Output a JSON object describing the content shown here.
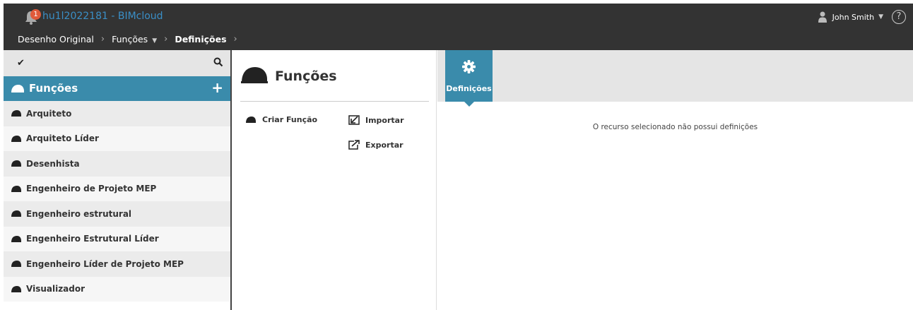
{
  "topbar": {
    "notification_count": "1",
    "app_title": "hu1l2022181 - BIMcloud",
    "breadcrumb": [
      {
        "label": "Desenho Original"
      },
      {
        "label": "Funções"
      },
      {
        "label": "Definições"
      }
    ],
    "user_name": "John Smith",
    "help_symbol": "?",
    "accent_color": "#3a8fc7"
  },
  "left_panel": {
    "header_title": "Funções",
    "header_color": "#3a8bab",
    "items": [
      {
        "label": "Arquiteto"
      },
      {
        "label": "Arquiteto Líder"
      },
      {
        "label": "Desenhista"
      },
      {
        "label": "Engenheiro de Projeto MEP"
      },
      {
        "label": "Engenheiro estrutural"
      },
      {
        "label": "Engenheiro Estrutural Líder"
      },
      {
        "label": "Engenheiro Líder de Projeto MEP"
      },
      {
        "label": "Visualizador"
      }
    ]
  },
  "middle_panel": {
    "title": "Funções",
    "create_label": "Criar Função",
    "import_label": "Importar",
    "export_label": "Exportar"
  },
  "right_panel": {
    "tab_label": "Definições",
    "empty_message": "O recurso selecionado não possui definições"
  }
}
